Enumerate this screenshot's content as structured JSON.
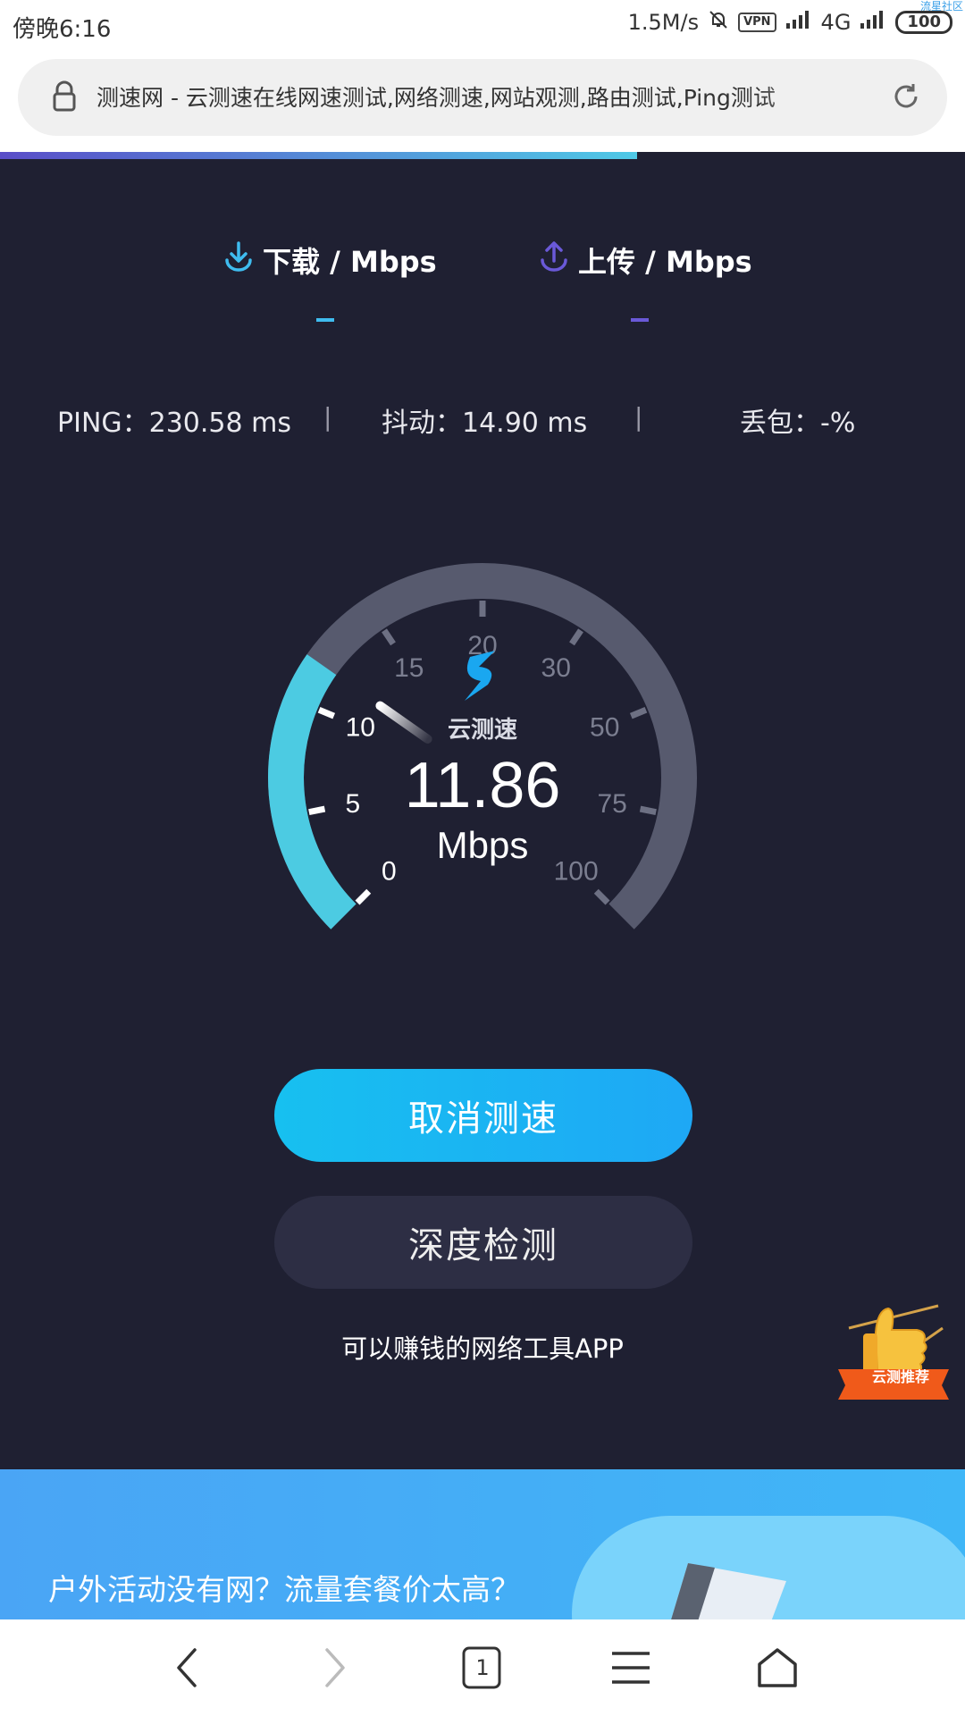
{
  "status_bar": {
    "time": "傍晚6:16",
    "net_speed": "1.5M/s",
    "vpn_label": "VPN",
    "network": "4G",
    "battery": "100",
    "corner_tag": "流星社区"
  },
  "address_bar": {
    "title": "测速网 - 云测速在线网速测试,网络测速,网站观测,路由测试,Ping测试"
  },
  "page_progress": 0.66,
  "metrics": {
    "download_label": "下载 / Mbps",
    "upload_label": "上传 / Mbps",
    "download_value": "",
    "upload_value": ""
  },
  "stats": {
    "ping": "PING：230.58 ms",
    "jitter": "抖动：14.90 ms",
    "loss": "丢包：-%",
    "separator": "|"
  },
  "gauge": {
    "brand": "云测速",
    "value": "11.86",
    "unit": "Mbps",
    "current": 11.86,
    "ticks": [
      "0",
      "5",
      "10",
      "15",
      "20",
      "30",
      "50",
      "75",
      "100"
    ],
    "active_color": "#4ccbe2",
    "track_color": "#575a6e"
  },
  "buttons": {
    "cancel": "取消测速",
    "deep_check": "深度检测"
  },
  "earn_link": "可以赚钱的网络工具APP",
  "badge_label": "云测推荐",
  "banner": {
    "text": "户外活动没有网？流量套餐价太高？"
  },
  "bottom_nav": {
    "tab_count": "1"
  },
  "colors": {
    "panel_bg": "#1f2032",
    "download_accent": "#3fbcef",
    "upload_accent": "#6a59d8",
    "cancel_button": "#17c0f0"
  }
}
